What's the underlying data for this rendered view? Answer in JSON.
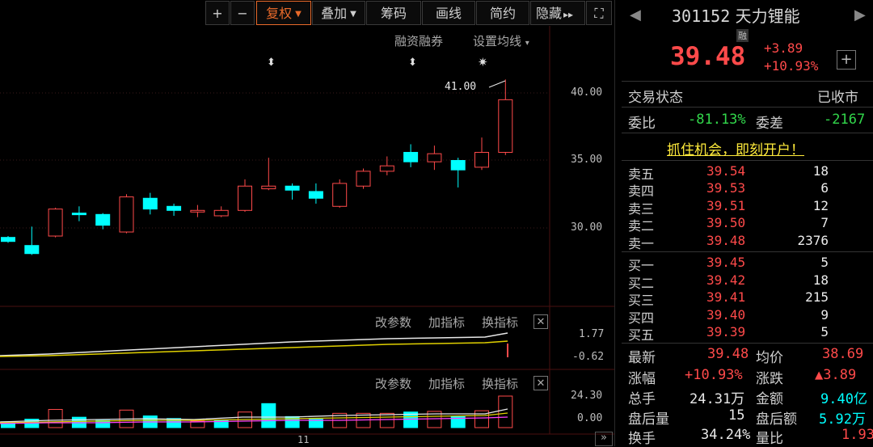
{
  "toolbar": {
    "plus": "+",
    "minus": "−",
    "fuquan": "复权",
    "diejia": "叠加",
    "chouma": "筹码",
    "huaxian": "画线",
    "jianyue": "简约",
    "yincang": "隐藏",
    "more": "▸▸",
    "fullscreen": "⛶"
  },
  "chart": {
    "rzrq": "融资融券",
    "set_ma": "设置均线",
    "high_label": "41.00",
    "price_ticks": [
      "40.00",
      "35.00",
      "30.00"
    ],
    "ind1": {
      "edit": "改参数",
      "add": "加指标",
      "switch": "换指标",
      "close": "✕",
      "v1": "1.77",
      "v2": "-0.62"
    },
    "ind2": {
      "edit": "改参数",
      "add": "加指标",
      "switch": "换指标",
      "close": "✕",
      "v1": "24.30",
      "v2": "0.00"
    },
    "date_tick": "11",
    "scroll_more": "»"
  },
  "chart_data": {
    "type": "candlestick",
    "y_range": [
      26.0,
      42.0
    ],
    "candles": [
      {
        "o": 29.3,
        "c": 29.0,
        "h": 29.4,
        "l": 28.9
      },
      {
        "o": 28.7,
        "c": 28.1,
        "h": 30.1,
        "l": 28.0
      },
      {
        "o": 29.4,
        "c": 31.4,
        "h": 31.5,
        "l": 29.3
      },
      {
        "o": 31.1,
        "c": 31.0,
        "h": 31.6,
        "l": 30.5
      },
      {
        "o": 31.0,
        "c": 30.2,
        "h": 31.1,
        "l": 29.9
      },
      {
        "o": 29.7,
        "c": 32.3,
        "h": 32.5,
        "l": 29.6
      },
      {
        "o": 32.2,
        "c": 31.4,
        "h": 32.6,
        "l": 31.0
      },
      {
        "o": 31.6,
        "c": 31.3,
        "h": 31.8,
        "l": 30.9
      },
      {
        "o": 31.2,
        "c": 31.3,
        "h": 31.7,
        "l": 30.8
      },
      {
        "o": 30.9,
        "c": 31.3,
        "h": 31.6,
        "l": 30.8
      },
      {
        "o": 31.3,
        "c": 33.1,
        "h": 33.6,
        "l": 31.2
      },
      {
        "o": 32.9,
        "c": 33.1,
        "h": 35.2,
        "l": 32.8
      },
      {
        "o": 33.1,
        "c": 32.8,
        "h": 33.3,
        "l": 32.1
      },
      {
        "o": 32.7,
        "c": 32.2,
        "h": 33.3,
        "l": 31.8
      },
      {
        "o": 31.6,
        "c": 33.3,
        "h": 33.6,
        "l": 31.5
      },
      {
        "o": 33.1,
        "c": 34.2,
        "h": 34.4,
        "l": 32.9
      },
      {
        "o": 34.2,
        "c": 34.6,
        "h": 35.3,
        "l": 33.9
      },
      {
        "o": 35.6,
        "c": 34.9,
        "h": 36.2,
        "l": 34.5
      },
      {
        "o": 34.9,
        "c": 35.5,
        "h": 36.1,
        "l": 34.3
      },
      {
        "o": 35.0,
        "c": 34.3,
        "h": 35.2,
        "l": 33.0
      },
      {
        "o": 34.5,
        "c": 35.6,
        "h": 36.7,
        "l": 34.3
      },
      {
        "o": 35.6,
        "c": 39.5,
        "h": 41.0,
        "l": 35.4
      }
    ],
    "volume": [
      {
        "v": 4.5,
        "up": false
      },
      {
        "v": 6.5,
        "up": false
      },
      {
        "v": 14.0,
        "up": true
      },
      {
        "v": 8.0,
        "up": false
      },
      {
        "v": 5.5,
        "up": false
      },
      {
        "v": 13.5,
        "up": true
      },
      {
        "v": 9.0,
        "up": false
      },
      {
        "v": 7.0,
        "up": false
      },
      {
        "v": 5.0,
        "up": true
      },
      {
        "v": 5.5,
        "up": false
      },
      {
        "v": 12.0,
        "up": true
      },
      {
        "v": 18.5,
        "up": false
      },
      {
        "v": 8.5,
        "up": false
      },
      {
        "v": 6.5,
        "up": false
      },
      {
        "v": 11.0,
        "up": true
      },
      {
        "v": 11.0,
        "up": true
      },
      {
        "v": 11.0,
        "up": true
      },
      {
        "v": 12.0,
        "up": false
      },
      {
        "v": 12.5,
        "up": true
      },
      {
        "v": 8.5,
        "up": false
      },
      {
        "v": 13.0,
        "up": true
      },
      {
        "v": 24.3,
        "up": true
      }
    ]
  },
  "panel": {
    "code": "301152",
    "name": "天力锂能",
    "rong": "融",
    "price": "39.48",
    "change": "+3.89",
    "change_pct": "+10.93%",
    "add": "+",
    "trade_status_label": "交易状态",
    "trade_status": "已收市",
    "weibi_label": "委比",
    "weibi": "-81.13%",
    "weicha_label": "委差",
    "weicha": "-2167",
    "promo": "抓住机会，即刻开户！",
    "asks": [
      {
        "label": "卖五",
        "price": "39.54",
        "vol": "18"
      },
      {
        "label": "卖四",
        "price": "39.53",
        "vol": "6"
      },
      {
        "label": "卖三",
        "price": "39.51",
        "vol": "12"
      },
      {
        "label": "卖二",
        "price": "39.50",
        "vol": "7"
      },
      {
        "label": "卖一",
        "price": "39.48",
        "vol": "2376"
      }
    ],
    "bids": [
      {
        "label": "买一",
        "price": "39.45",
        "vol": "5"
      },
      {
        "label": "买二",
        "price": "39.42",
        "vol": "18"
      },
      {
        "label": "买三",
        "price": "39.41",
        "vol": "215"
      },
      {
        "label": "买四",
        "price": "39.40",
        "vol": "9"
      },
      {
        "label": "买五",
        "price": "39.39",
        "vol": "5"
      }
    ],
    "stats": {
      "latest_label": "最新",
      "latest": "39.48",
      "avg_label": "均价",
      "avg": "38.69",
      "chg_pct_label": "涨幅",
      "chg_pct": "+10.93%",
      "chg_label": "涨跌",
      "chg": "▲3.89",
      "total_label": "总手",
      "total": "24.31万",
      "amount_label": "金额",
      "amount": "9.40亿",
      "after_vol_label": "盘后量",
      "after_vol": "15",
      "after_amt_label": "盘后额",
      "after_amt": "5.92万",
      "turnover_label": "换手",
      "turnover": "34.24%",
      "volratio_label": "量比",
      "volratio": "1.93"
    }
  }
}
